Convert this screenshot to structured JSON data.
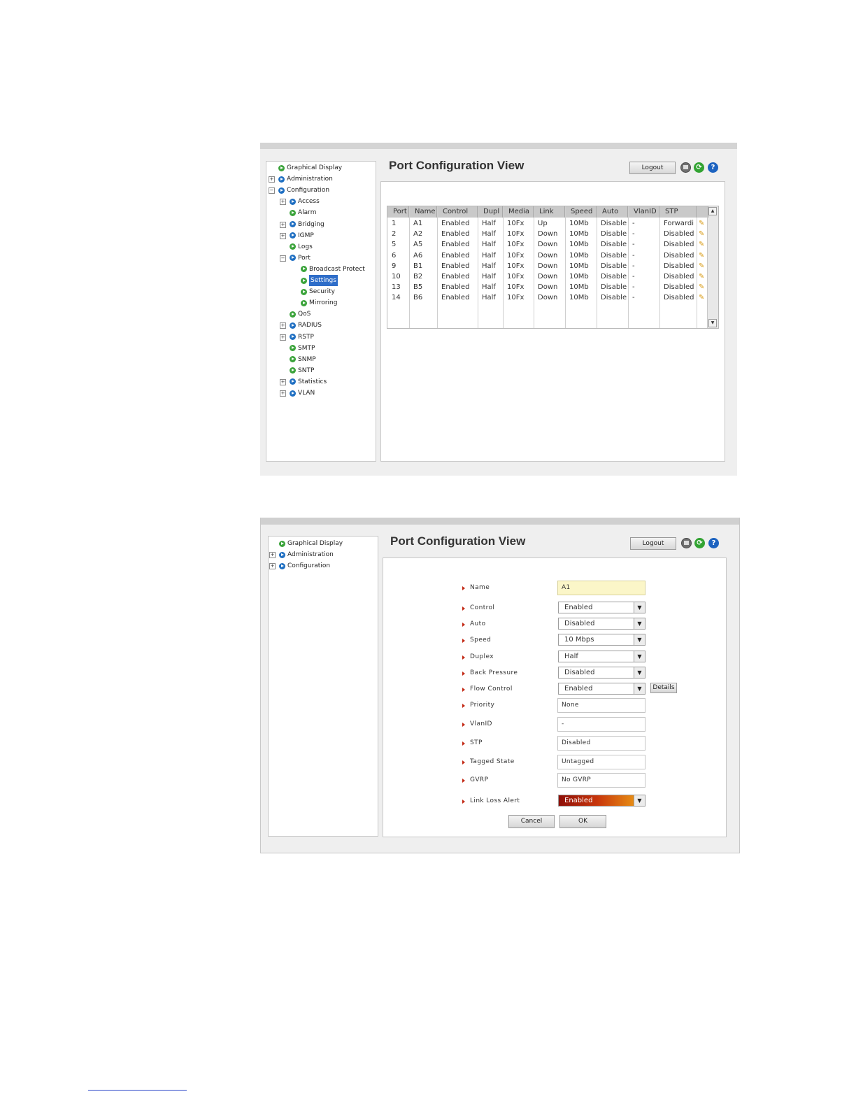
{
  "screen1": {
    "title": "Port Configuration View",
    "logout_label": "Logout",
    "tree": [
      {
        "label": "Graphical Display",
        "expander": "",
        "bullet": "green"
      },
      {
        "label": "Administration",
        "expander": "+",
        "bullet": "blue"
      },
      {
        "label": "Configuration",
        "expander": "−",
        "bullet": "blue"
      },
      {
        "label": "Access",
        "expander": "+",
        "bullet": "blue"
      },
      {
        "label": "Alarm",
        "expander": "",
        "bullet": "green"
      },
      {
        "label": "Bridging",
        "expander": "+",
        "bullet": "blue"
      },
      {
        "label": "IGMP",
        "expander": "+",
        "bullet": "blue"
      },
      {
        "label": "Logs",
        "expander": "",
        "bullet": "green"
      },
      {
        "label": "Port",
        "expander": "−",
        "bullet": "blue"
      },
      {
        "label": "Broadcast Protect",
        "expander": "",
        "bullet": "green"
      },
      {
        "label": "Settings",
        "expander": "",
        "bullet": "green",
        "selected": true
      },
      {
        "label": "Security",
        "expander": "",
        "bullet": "green"
      },
      {
        "label": "Mirroring",
        "expander": "",
        "bullet": "green"
      },
      {
        "label": "QoS",
        "expander": "",
        "bullet": "green"
      },
      {
        "label": "RADIUS",
        "expander": "+",
        "bullet": "blue"
      },
      {
        "label": "RSTP",
        "expander": "+",
        "bullet": "blue"
      },
      {
        "label": "SMTP",
        "expander": "",
        "bullet": "green"
      },
      {
        "label": "SNMP",
        "expander": "",
        "bullet": "green"
      },
      {
        "label": "SNTP",
        "expander": "",
        "bullet": "green"
      },
      {
        "label": "Statistics",
        "expander": "+",
        "bullet": "blue"
      },
      {
        "label": "VLAN",
        "expander": "+",
        "bullet": "blue"
      }
    ],
    "table": {
      "columns": [
        "Port",
        "Name",
        "Control",
        "Dupl",
        "Media",
        "Link",
        "Speed",
        "Auto",
        "VlanID",
        "STP",
        ""
      ],
      "rows": [
        [
          "1",
          "A1",
          "Enabled",
          "Half",
          "10Fx",
          "Up",
          "10Mb",
          "Disable",
          "-",
          "Forwardi"
        ],
        [
          "2",
          "A2",
          "Enabled",
          "Half",
          "10Fx",
          "Down",
          "10Mb",
          "Disable",
          "-",
          "Disabled"
        ],
        [
          "5",
          "A5",
          "Enabled",
          "Half",
          "10Fx",
          "Down",
          "10Mb",
          "Disable",
          "-",
          "Disabled"
        ],
        [
          "6",
          "A6",
          "Enabled",
          "Half",
          "10Fx",
          "Down",
          "10Mb",
          "Disable",
          "-",
          "Disabled"
        ],
        [
          "9",
          "B1",
          "Enabled",
          "Half",
          "10Fx",
          "Down",
          "10Mb",
          "Disable",
          "-",
          "Disabled"
        ],
        [
          "10",
          "B2",
          "Enabled",
          "Half",
          "10Fx",
          "Down",
          "10Mb",
          "Disable",
          "-",
          "Disabled"
        ],
        [
          "13",
          "B5",
          "Enabled",
          "Half",
          "10Fx",
          "Down",
          "10Mb",
          "Disable",
          "-",
          "Disabled"
        ],
        [
          "14",
          "B6",
          "Enabled",
          "Half",
          "10Fx",
          "Down",
          "10Mb",
          "Disable",
          "-",
          "Disabled"
        ]
      ]
    }
  },
  "screen2": {
    "title": "Port Configuration View",
    "logout_label": "Logout",
    "tree": [
      {
        "label": "Graphical Display",
        "expander": "",
        "bullet": "green"
      },
      {
        "label": "Administration",
        "expander": "+",
        "bullet": "blue"
      },
      {
        "label": "Configuration",
        "expander": "+",
        "bullet": "blue"
      }
    ],
    "form": [
      {
        "label": "Name",
        "type": "input",
        "value": "A1",
        "highlight": true
      },
      {
        "label": "Control",
        "type": "select",
        "value": "Enabled"
      },
      {
        "label": "Auto",
        "type": "select",
        "value": "Disabled"
      },
      {
        "label": "Speed",
        "type": "select",
        "value": "10 Mbps"
      },
      {
        "label": "Duplex",
        "type": "select",
        "value": "Half"
      },
      {
        "label": "Back Pressure",
        "type": "select",
        "value": "Disabled"
      },
      {
        "label": "Flow Control",
        "type": "select",
        "value": "Enabled"
      },
      {
        "label": "Priority",
        "type": "input",
        "value": "None"
      },
      {
        "label": "VlanID",
        "type": "input",
        "value": "-"
      },
      {
        "label": "STP",
        "type": "input",
        "value": "Disabled"
      },
      {
        "label": "Tagged State",
        "type": "input",
        "value": "Untagged"
      },
      {
        "label": "GVRP",
        "type": "input",
        "value": "No GVRP"
      },
      {
        "label": "Link Loss Alert",
        "type": "select",
        "value": "Enabled",
        "alert": true
      }
    ],
    "details_label": "Details",
    "cancel_label": "Cancel",
    "ok_label": "OK"
  }
}
